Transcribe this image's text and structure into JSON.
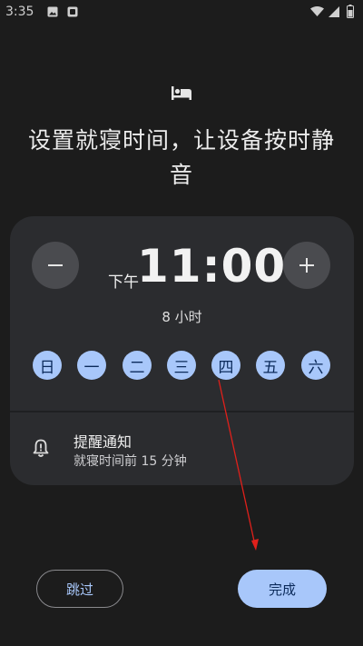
{
  "status_bar": {
    "time": "3:35",
    "icons": [
      "image-icon",
      "notification-icon",
      "wifi-icon",
      "signal-icon",
      "battery-icon"
    ]
  },
  "header": {
    "icon": "bed-icon",
    "title": "设置就寝时间，让设备按时静音"
  },
  "time_picker": {
    "decrease_icon": "minus-icon",
    "increase_icon": "plus-icon",
    "period": "下午",
    "time": "11:00",
    "duration": "8 小时"
  },
  "days": [
    {
      "label": "日",
      "selected": true
    },
    {
      "label": "一",
      "selected": true
    },
    {
      "label": "二",
      "selected": true
    },
    {
      "label": "三",
      "selected": true
    },
    {
      "label": "四",
      "selected": true
    },
    {
      "label": "五",
      "selected": true
    },
    {
      "label": "六",
      "selected": true
    }
  ],
  "reminder": {
    "icon": "alarm-bell-icon",
    "title": "提醒通知",
    "subtitle": "就寝时间前 15 分钟"
  },
  "actions": {
    "skip": "跳过",
    "done": "完成"
  },
  "colors": {
    "background": "#1c1c1c",
    "card": "#2b2c2f",
    "accent": "#a8c7fa",
    "round_button": "#4a4b4f",
    "annotation_arrow": "#e0201b"
  }
}
